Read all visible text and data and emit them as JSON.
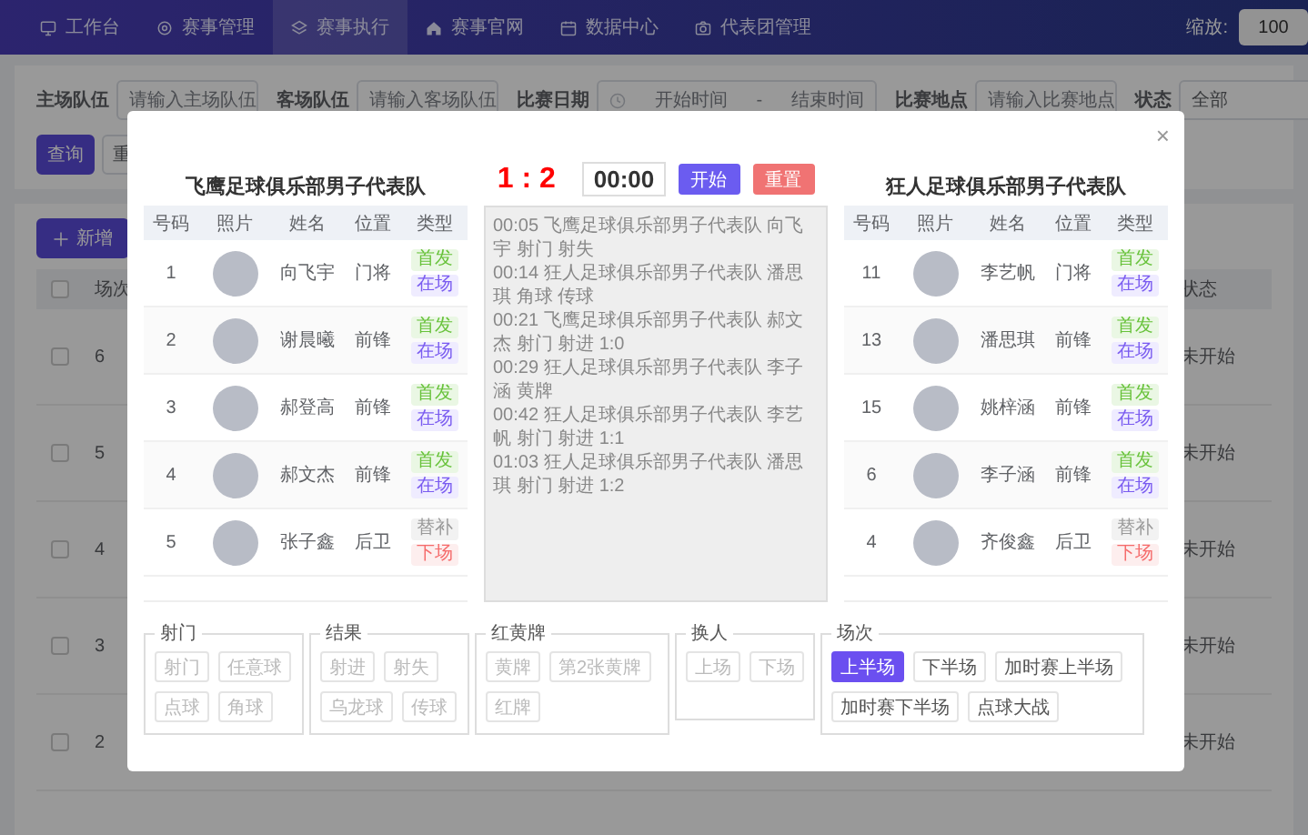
{
  "nav": {
    "items": [
      {
        "label": "工作台",
        "selected": false
      },
      {
        "label": "赛事管理",
        "selected": false
      },
      {
        "label": "赛事执行",
        "selected": true
      },
      {
        "label": "赛事官网",
        "selected": false
      },
      {
        "label": "数据中心",
        "selected": false
      },
      {
        "label": "代表团管理",
        "selected": false
      }
    ],
    "zoom": {
      "label": "缩放:",
      "value": "100"
    }
  },
  "filters": [
    {
      "kind": "text",
      "label": "主场队伍",
      "placeholder": "请输入主场队伍"
    },
    {
      "kind": "text",
      "label": "客场队伍",
      "placeholder": "请输入客场队伍"
    },
    {
      "kind": "daterange",
      "label": "比赛日期",
      "start": "开始时间",
      "separator": "-",
      "end": "结束时间"
    },
    {
      "kind": "text",
      "label": "比赛地点",
      "placeholder": "请输入比赛地点"
    },
    {
      "kind": "select",
      "label": "状态",
      "value": "全部"
    }
  ],
  "actions": {
    "search": "查询",
    "reset": "重",
    "add": "新增"
  },
  "table": {
    "columns": [
      "场次",
      "状态"
    ],
    "header_checked": false,
    "rows": [
      {
        "number": "6",
        "status": "未开始",
        "checked": false
      },
      {
        "number": "5",
        "status": "未开始",
        "checked": false
      },
      {
        "number": "4",
        "status": "未开始",
        "checked": false
      },
      {
        "number": "3",
        "status": "未开始",
        "checked": false
      },
      {
        "number": "2",
        "status": "未开始",
        "checked": false
      }
    ]
  },
  "modal": {
    "score": "1 : 2",
    "timer": "00:00",
    "start_button": "开始",
    "reset_button": "重置",
    "close": "×",
    "home_team": {
      "name": "飞鹰足球俱乐部男子代表队",
      "columns": [
        "号码",
        "照片",
        "姓名",
        "位置",
        "类型"
      ],
      "players": [
        {
          "number": "1",
          "name": "向飞宇",
          "position": "门将",
          "tags": [
            {
              "label": "首发",
              "kind": "starter"
            },
            {
              "label": "在场",
              "kind": "on"
            }
          ]
        },
        {
          "number": "2",
          "name": "谢晨曦",
          "position": "前锋",
          "tags": [
            {
              "label": "首发",
              "kind": "starter"
            },
            {
              "label": "在场",
              "kind": "on"
            }
          ]
        },
        {
          "number": "3",
          "name": "郝登高",
          "position": "前锋",
          "tags": [
            {
              "label": "首发",
              "kind": "starter"
            },
            {
              "label": "在场",
              "kind": "on"
            }
          ]
        },
        {
          "number": "4",
          "name": "郝文杰",
          "position": "前锋",
          "tags": [
            {
              "label": "首发",
              "kind": "starter"
            },
            {
              "label": "在场",
              "kind": "on"
            }
          ]
        },
        {
          "number": "5",
          "name": "张子鑫",
          "position": "后卫",
          "tags": [
            {
              "label": "替补",
              "kind": "sub"
            },
            {
              "label": "下场",
              "kind": "off"
            }
          ]
        }
      ]
    },
    "away_team": {
      "name": "狂人足球俱乐部男子代表队",
      "columns": [
        "号码",
        "照片",
        "姓名",
        "位置",
        "类型"
      ],
      "players": [
        {
          "number": "11",
          "name": "李艺帆",
          "position": "门将",
          "tags": [
            {
              "label": "首发",
              "kind": "starter"
            },
            {
              "label": "在场",
              "kind": "on"
            }
          ]
        },
        {
          "number": "13",
          "name": "潘思琪",
          "position": "前锋",
          "tags": [
            {
              "label": "首发",
              "kind": "starter"
            },
            {
              "label": "在场",
              "kind": "on"
            }
          ]
        },
        {
          "number": "15",
          "name": "姚梓涵",
          "position": "前锋",
          "tags": [
            {
              "label": "首发",
              "kind": "starter"
            },
            {
              "label": "在场",
              "kind": "on"
            }
          ]
        },
        {
          "number": "6",
          "name": "李子涵",
          "position": "前锋",
          "tags": [
            {
              "label": "首发",
              "kind": "starter"
            },
            {
              "label": "在场",
              "kind": "on"
            }
          ]
        },
        {
          "number": "4",
          "name": "齐俊鑫",
          "position": "后卫",
          "tags": [
            {
              "label": "替补",
              "kind": "sub"
            },
            {
              "label": "下场",
              "kind": "off"
            }
          ]
        }
      ]
    },
    "log": [
      "00:05 飞鹰足球俱乐部男子代表队 向飞宇 射门 射失",
      "00:14 狂人足球俱乐部男子代表队 潘思琪 角球 传球",
      "00:21 飞鹰足球俱乐部男子代表队 郝文杰 射门 射进 1:0",
      "00:29 狂人足球俱乐部男子代表队 李子涵 黄牌",
      "00:42 狂人足球俱乐部男子代表队 李艺帆 射门 射进 1:1",
      "01:03 狂人足球俱乐部男子代表队 潘思琪 射门 射进 1:2"
    ],
    "groups": [
      {
        "title": "射门",
        "buttons": [
          {
            "label": "射门",
            "disabled": true,
            "selected": false
          },
          {
            "label": "任意球",
            "disabled": true,
            "selected": false
          },
          {
            "label": "点球",
            "disabled": true,
            "selected": false
          },
          {
            "label": "角球",
            "disabled": true,
            "selected": false
          }
        ]
      },
      {
        "title": "结果",
        "buttons": [
          {
            "label": "射进",
            "disabled": true,
            "selected": false
          },
          {
            "label": "射失",
            "disabled": true,
            "selected": false
          },
          {
            "label": "乌龙球",
            "disabled": true,
            "selected": false
          },
          {
            "label": "传球",
            "disabled": true,
            "selected": false
          }
        ]
      },
      {
        "title": "红黄牌",
        "buttons": [
          {
            "label": "黄牌",
            "disabled": true,
            "selected": false
          },
          {
            "label": "第2张黄牌",
            "disabled": true,
            "selected": false
          },
          {
            "label": "红牌",
            "disabled": true,
            "selected": false
          }
        ]
      },
      {
        "title": "换人",
        "buttons": [
          {
            "label": "上场",
            "disabled": true,
            "selected": false
          },
          {
            "label": "下场",
            "disabled": true,
            "selected": false
          }
        ]
      },
      {
        "title": "场次",
        "buttons": [
          {
            "label": "上半场",
            "disabled": false,
            "selected": true
          },
          {
            "label": "下半场",
            "disabled": false,
            "selected": false
          },
          {
            "label": "加时赛上半场",
            "disabled": false,
            "selected": false
          },
          {
            "label": "加时赛下半场",
            "disabled": false,
            "selected": false
          },
          {
            "label": "点球大战",
            "disabled": false,
            "selected": false
          }
        ]
      }
    ]
  }
}
